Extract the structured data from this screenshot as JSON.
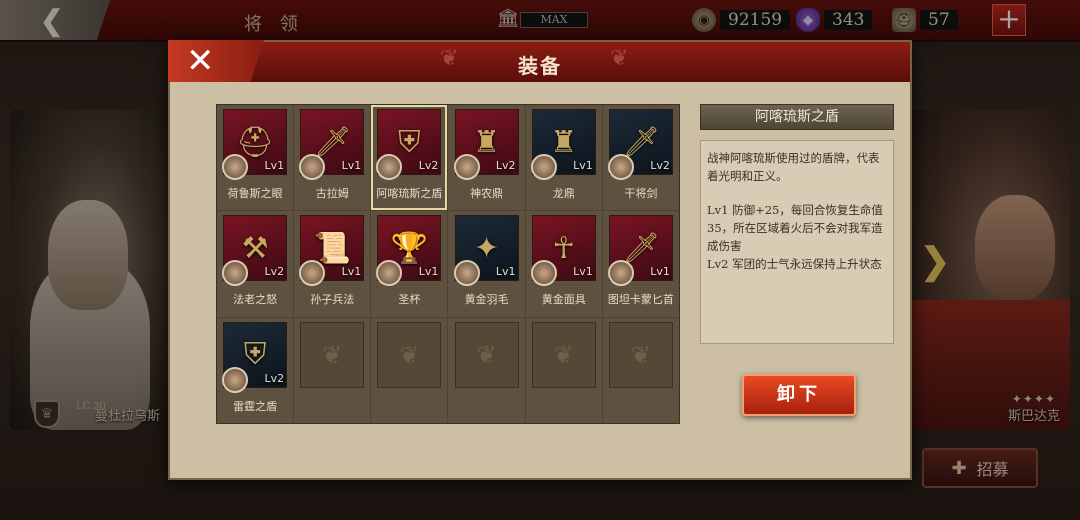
{
  "topbar": {
    "title": "将 领",
    "storage_label": "MAX",
    "coins": "92159",
    "gems": "343",
    "troops": "57"
  },
  "heroes": {
    "left_name": "曼杜拉乌斯",
    "left_level": "LC.30",
    "right_name": "斯巴达克"
  },
  "recruit_label": "招募",
  "modal": {
    "title": "装备",
    "unequip_label": "卸下"
  },
  "equipment": [
    {
      "name": "荷鲁斯之眼",
      "level": "Lv1",
      "glyph": "⛑",
      "style": "red"
    },
    {
      "name": "古拉姆",
      "level": "Lv1",
      "glyph": "🗡",
      "style": "red"
    },
    {
      "name": "阿喀琉斯之盾",
      "level": "Lv2",
      "glyph": "⛨",
      "style": "red"
    },
    {
      "name": "神农鼎",
      "level": "Lv2",
      "glyph": "♜",
      "style": "red"
    },
    {
      "name": "龙鼎",
      "level": "Lv1",
      "glyph": "♜",
      "style": "dark"
    },
    {
      "name": "干将剑",
      "level": "Lv2",
      "glyph": "🗡",
      "style": "dark"
    },
    {
      "name": "法老之怒",
      "level": "Lv2",
      "glyph": "⚒",
      "style": "red"
    },
    {
      "name": "孙子兵法",
      "level": "Lv1",
      "glyph": "📜",
      "style": "red"
    },
    {
      "name": "圣杯",
      "level": "Lv1",
      "glyph": "🏆",
      "style": "red"
    },
    {
      "name": "黄金羽毛",
      "level": "Lv1",
      "glyph": "✦",
      "style": "dark"
    },
    {
      "name": "黄金面具",
      "level": "Lv1",
      "glyph": "☥",
      "style": "red"
    },
    {
      "name": "图坦卡蒙匕首",
      "level": "Lv1",
      "glyph": "🗡",
      "style": "red"
    },
    {
      "name": "雷霆之盾",
      "level": "Lv2",
      "glyph": "⛨",
      "style": "dark"
    }
  ],
  "detail": {
    "title": "阿喀琉斯之盾",
    "description": "战神阿喀琉斯使用过的盾牌，代表着光明和正义。",
    "lv1_effect": "Lv1 防御+25，每回合恢复生命值35，所在区域着火后不会对我军造成伤害",
    "lv2_effect": "Lv2 军团的士气永远保持上升状态"
  },
  "colors": {
    "header_red": "#8c1c14",
    "button_orange": "#e84a24",
    "panel_beige": "#cdbfa4"
  }
}
